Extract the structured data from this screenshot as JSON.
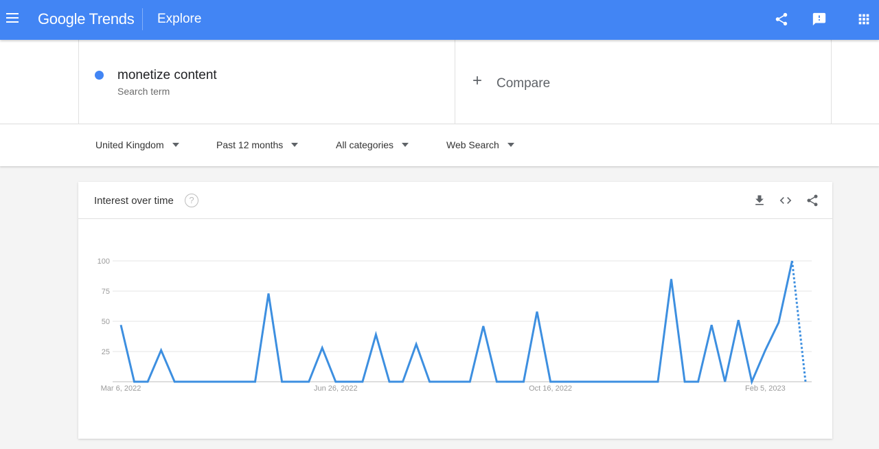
{
  "header": {
    "brand": "Google Trends",
    "page": "Explore",
    "icons": [
      "menu-icon",
      "share-icon",
      "feedback-icon",
      "apps-icon"
    ]
  },
  "search": {
    "term": "monetize content",
    "term_type": "Search term",
    "term_color": "#4285f4",
    "compare_label": "Compare"
  },
  "filters": {
    "region": "United Kingdom",
    "time": "Past 12 months",
    "category": "All categories",
    "property": "Web Search"
  },
  "card": {
    "title": "Interest over time",
    "help": "?",
    "icons": [
      "download-icon",
      "embed-icon",
      "share-icon"
    ]
  },
  "chart_data": {
    "type": "line",
    "title": "Interest over time",
    "ylim": [
      0,
      100
    ],
    "yticks": [
      25,
      50,
      75,
      100
    ],
    "xtick_labels": [
      "Mar 6, 2022",
      "Jun 26, 2022",
      "Oct 16, 2022",
      "Feb 5, 2023"
    ],
    "xtick_index": [
      0,
      16,
      32,
      48
    ],
    "grid": true,
    "line_color": "#3d8fe0",
    "partial_last_point": true,
    "series": [
      {
        "values": [
          47,
          0,
          0,
          26,
          0,
          0,
          0,
          0,
          0,
          0,
          0,
          73,
          0,
          0,
          0,
          28,
          0,
          0,
          0,
          39,
          0,
          0,
          31,
          0,
          0,
          0,
          0,
          46,
          0,
          0,
          0,
          58,
          0,
          0,
          0,
          0,
          0,
          0,
          0,
          0,
          0,
          85,
          0,
          0,
          47,
          0,
          51,
          0,
          26,
          49,
          100,
          0
        ]
      }
    ]
  }
}
